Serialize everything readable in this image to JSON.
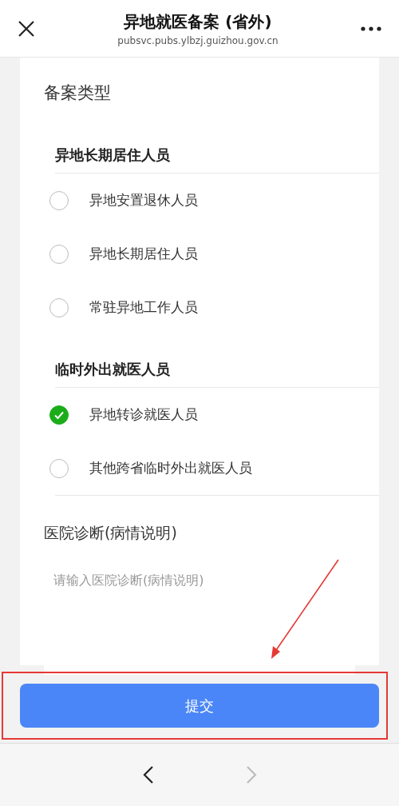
{
  "header": {
    "title": "异地就医备案 (省外)",
    "url": "pubsvc.pubs.ylbzj.guizhou.gov.cn"
  },
  "form": {
    "type_label": "备案类型",
    "groups": [
      {
        "title": "异地长期居住人员",
        "options": [
          {
            "label": "异地安置退休人员",
            "selected": false
          },
          {
            "label": "异地长期居住人员",
            "selected": false
          },
          {
            "label": "常驻异地工作人员",
            "selected": false
          }
        ]
      },
      {
        "title": "临时外出就医人员",
        "options": [
          {
            "label": "异地转诊就医人员",
            "selected": true
          },
          {
            "label": "其他跨省临时外出就医人员",
            "selected": false
          }
        ]
      }
    ],
    "diagnosis_label": "医院诊断(病情说明)",
    "diagnosis_placeholder": "请输入医院诊断(病情说明)"
  },
  "submit_button": "提交",
  "nav": {
    "back_disabled": false,
    "forward_disabled": true
  }
}
